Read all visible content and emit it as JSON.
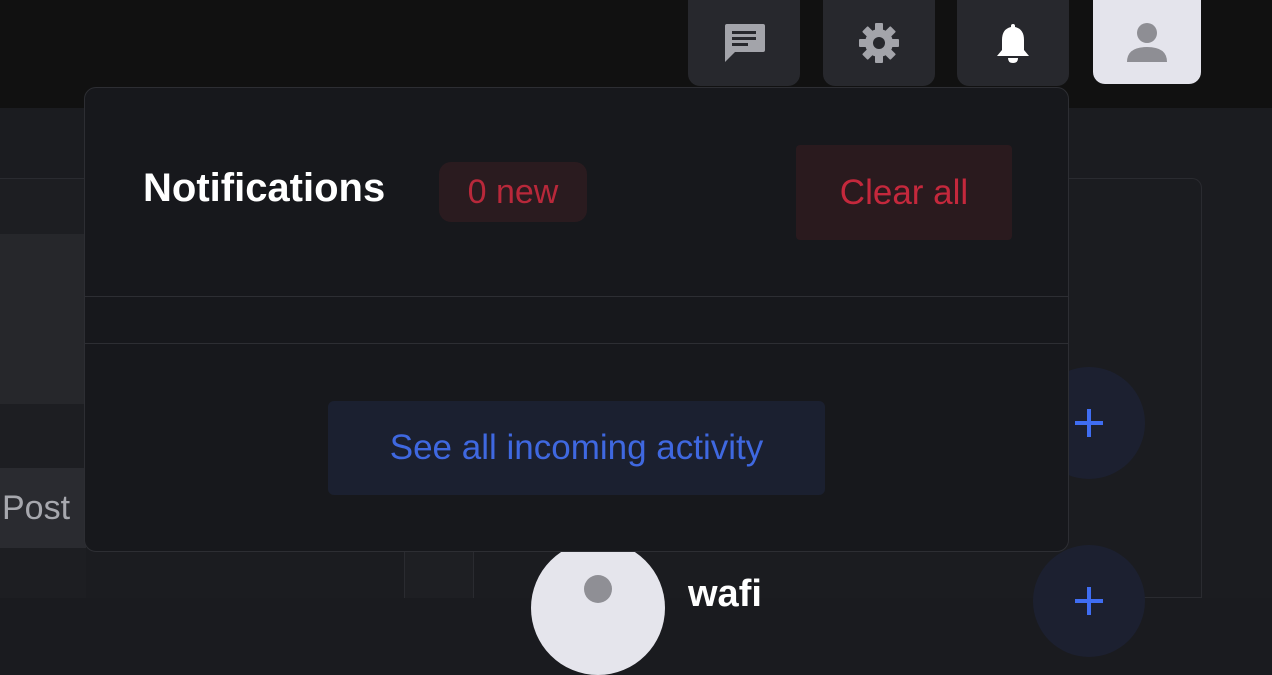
{
  "topbar": {
    "icons": [
      "chat-icon",
      "gear-icon",
      "bell-icon",
      "user-icon"
    ]
  },
  "background": {
    "post_label": "Post",
    "username": "wafi"
  },
  "notifications": {
    "title": "Notifications",
    "badge": "0 new",
    "clear_label": "Clear all",
    "footer_label": "See all incoming activity"
  },
  "colors": {
    "accent_blue": "#3f68e0",
    "danger_red": "#c4283c",
    "panel_bg": "#17181c"
  }
}
